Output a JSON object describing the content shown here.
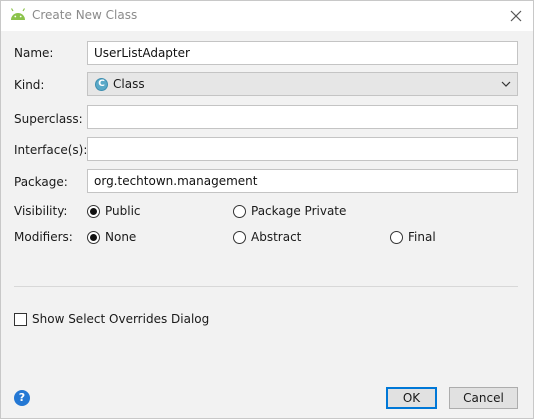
{
  "window": {
    "title": "Create New Class",
    "icon": "android-icon",
    "close_icon": "close-icon"
  },
  "form": {
    "name": {
      "label": "Name:",
      "value": "UserListAdapter"
    },
    "kind": {
      "label": "Kind:",
      "value": "Class",
      "icon": "class-c-icon",
      "icon_letter": "C",
      "icon_color": "#5aa9c8"
    },
    "superclass": {
      "label": "Superclass:",
      "value": ""
    },
    "interfaces": {
      "label": "Interface(s):",
      "value": ""
    },
    "package": {
      "label": "Package:",
      "value": "org.techtown.management"
    },
    "visibility": {
      "label": "Visibility:",
      "options": [
        {
          "label": "Public",
          "selected": true
        },
        {
          "label": "Package Private",
          "selected": false
        }
      ]
    },
    "modifiers": {
      "label": "Modifiers:",
      "options": [
        {
          "label": "None",
          "selected": true
        },
        {
          "label": "Abstract",
          "selected": false
        },
        {
          "label": "Final",
          "selected": false
        }
      ]
    },
    "show_overrides": {
      "label": "Show Select Overrides Dialog",
      "checked": false
    }
  },
  "footer": {
    "help_icon": "help-icon",
    "help_glyph": "?",
    "ok_label": "OK",
    "cancel_label": "Cancel"
  },
  "colors": {
    "accent": "#0078d7",
    "help": "#2478d4",
    "android": "#8bc34a"
  }
}
